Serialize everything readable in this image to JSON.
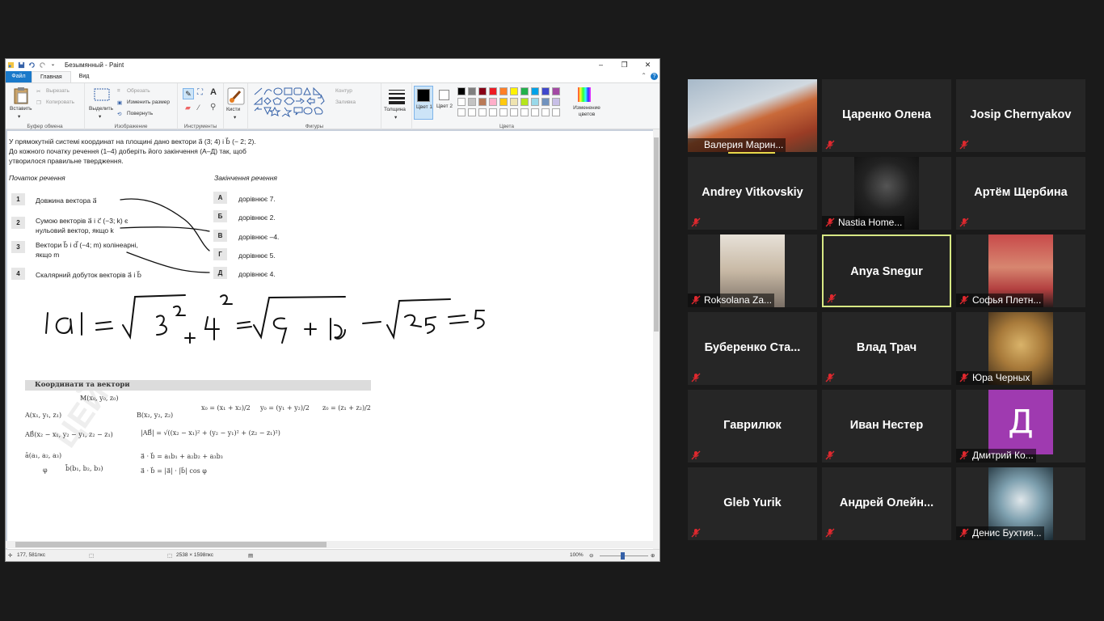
{
  "paint": {
    "title": "Безымянный - Paint",
    "tabs": {
      "file": "Файл",
      "home": "Главная",
      "view": "Вид"
    },
    "help": "?",
    "ribbon": {
      "clipboard": {
        "paste": "Вставить",
        "cut": "Вырезать",
        "copy": "Копировать",
        "label": "Буфер обмена"
      },
      "image": {
        "select": "Выделить",
        "crop": "Обрезать",
        "resize": "Изменить размер",
        "rotate": "Повернуть",
        "label": "Изображение"
      },
      "tools": {
        "label": "Инструменты"
      },
      "brushes": {
        "label": "Кисти"
      },
      "shapes": {
        "outline": "Контур",
        "fill": "Заливка",
        "label": "Фигуры"
      },
      "size": {
        "label": "Толщина"
      },
      "color1": "Цвет 1",
      "color2": "Цвет 2",
      "edit_colors": "Изменение цветов",
      "colors_label": "Цвета"
    },
    "palette": [
      "#000000",
      "#7f7f7f",
      "#880015",
      "#ed1c24",
      "#ff7f27",
      "#fff200",
      "#22b14c",
      "#00a2e8",
      "#3f48cc",
      "#a349a4",
      "#ffffff",
      "#c3c3c3",
      "#b97a57",
      "#ffaec9",
      "#ffc90e",
      "#efe4b0",
      "#b5e61d",
      "#99d9ea",
      "#7092be",
      "#c8bfe7"
    ],
    "status": {
      "cursor": "177, 581пкс",
      "size": "2538 × 1598пкс",
      "zoom": "100%"
    }
  },
  "doc": {
    "intro1": "У прямокутній системі координат на площині дано вектори a⃗ (3; 4) і b⃗ (− 2; 2).",
    "intro2": "До кожного початку речення (1–4) доберіть його закінчення (А–Д) так, щоб",
    "intro3": "утворилося правильне твердження.",
    "col_left": "Початок речення",
    "col_right": "Закінчення речення",
    "left_items": [
      {
        "n": "1",
        "t1": "Довжина вектора a⃗",
        "t2": ""
      },
      {
        "n": "2",
        "t1": "Сумою векторів a⃗ і c⃗ (−3; k) є",
        "t2": "нульовий вектор, якщо k"
      },
      {
        "n": "3",
        "t1": "Вектори b⃗ і d⃗ (−4; m) колінеарні,",
        "t2": "якщо m"
      },
      {
        "n": "4",
        "t1": "Скалярний добуток векторів a⃗ і b⃗",
        "t2": ""
      }
    ],
    "right_items": [
      {
        "l": "А",
        "t": "дорівнює 7."
      },
      {
        "l": "Б",
        "t": "дорівнює 2."
      },
      {
        "l": "В",
        "t": "дорівнює –4."
      },
      {
        "l": "Г",
        "t": "дорівнює 5."
      },
      {
        "l": "Д",
        "t": "дорівнює 4."
      }
    ],
    "section": "Координати та вектори",
    "watermark": "ЦЕЙ",
    "formulas": {
      "M": "M(x₀, y₀, z₀)",
      "A": "A(x₁, y₁, z₁)",
      "B": "B(x₂, y₂, z₂)",
      "x0": "x₀ = (x₁ + x₂)/2",
      "y0": "y₀ = (y₁ + y₂)/2",
      "z0": "z₀ = (z₁ + z₂)/2",
      "AB": "AB⃗(x₂ − x₁, y₂ − y₁, z₂ − z₁)",
      "ABlen": "|AB⃗| = √((x₂ − x₁)² + (y₂ − y₁)² + (z₂ − z₁)²)",
      "a": "ā(a₁, a₂, a₃)",
      "b": "b̄(b₁, b₂, b₃)",
      "phi": "φ",
      "dot1": "a⃗ · b⃗ = a₁b₁ + a₂b₂ + a₃b₃",
      "dot2": "a⃗ · b⃗ = |a⃗| · |b⃗| cos φ"
    }
  },
  "participants": [
    {
      "name": "Валерия Марин...",
      "video": true
    },
    {
      "name": "Царенко Олена",
      "video": false
    },
    {
      "name": "Josip Chernyakov",
      "video": false
    },
    {
      "name": "Andrey Vitkovskiy",
      "video": false
    },
    {
      "name": "Nastia Home...",
      "video": true
    },
    {
      "name": "Артём Щербина",
      "video": false
    },
    {
      "name": "Roksolana Za...",
      "video": true
    },
    {
      "name": "Anya Snegur",
      "video": false
    },
    {
      "name": "Софья Плетн...",
      "video": true
    },
    {
      "name": "Буберенко  Ста...",
      "video": false
    },
    {
      "name": "Влад Трач",
      "video": false
    },
    {
      "name": "Юра Черных",
      "video": true
    },
    {
      "name": "Гаврилюк",
      "video": false
    },
    {
      "name": "Иван Нестер",
      "video": false
    },
    {
      "name": "Дмитрий Ко...",
      "video": true,
      "avatar": "Д"
    },
    {
      "name": "Gleb Yurik",
      "video": false
    },
    {
      "name": "Андрей  Олейн...",
      "video": false
    },
    {
      "name": "Денис Бухтия...",
      "video": true
    }
  ]
}
